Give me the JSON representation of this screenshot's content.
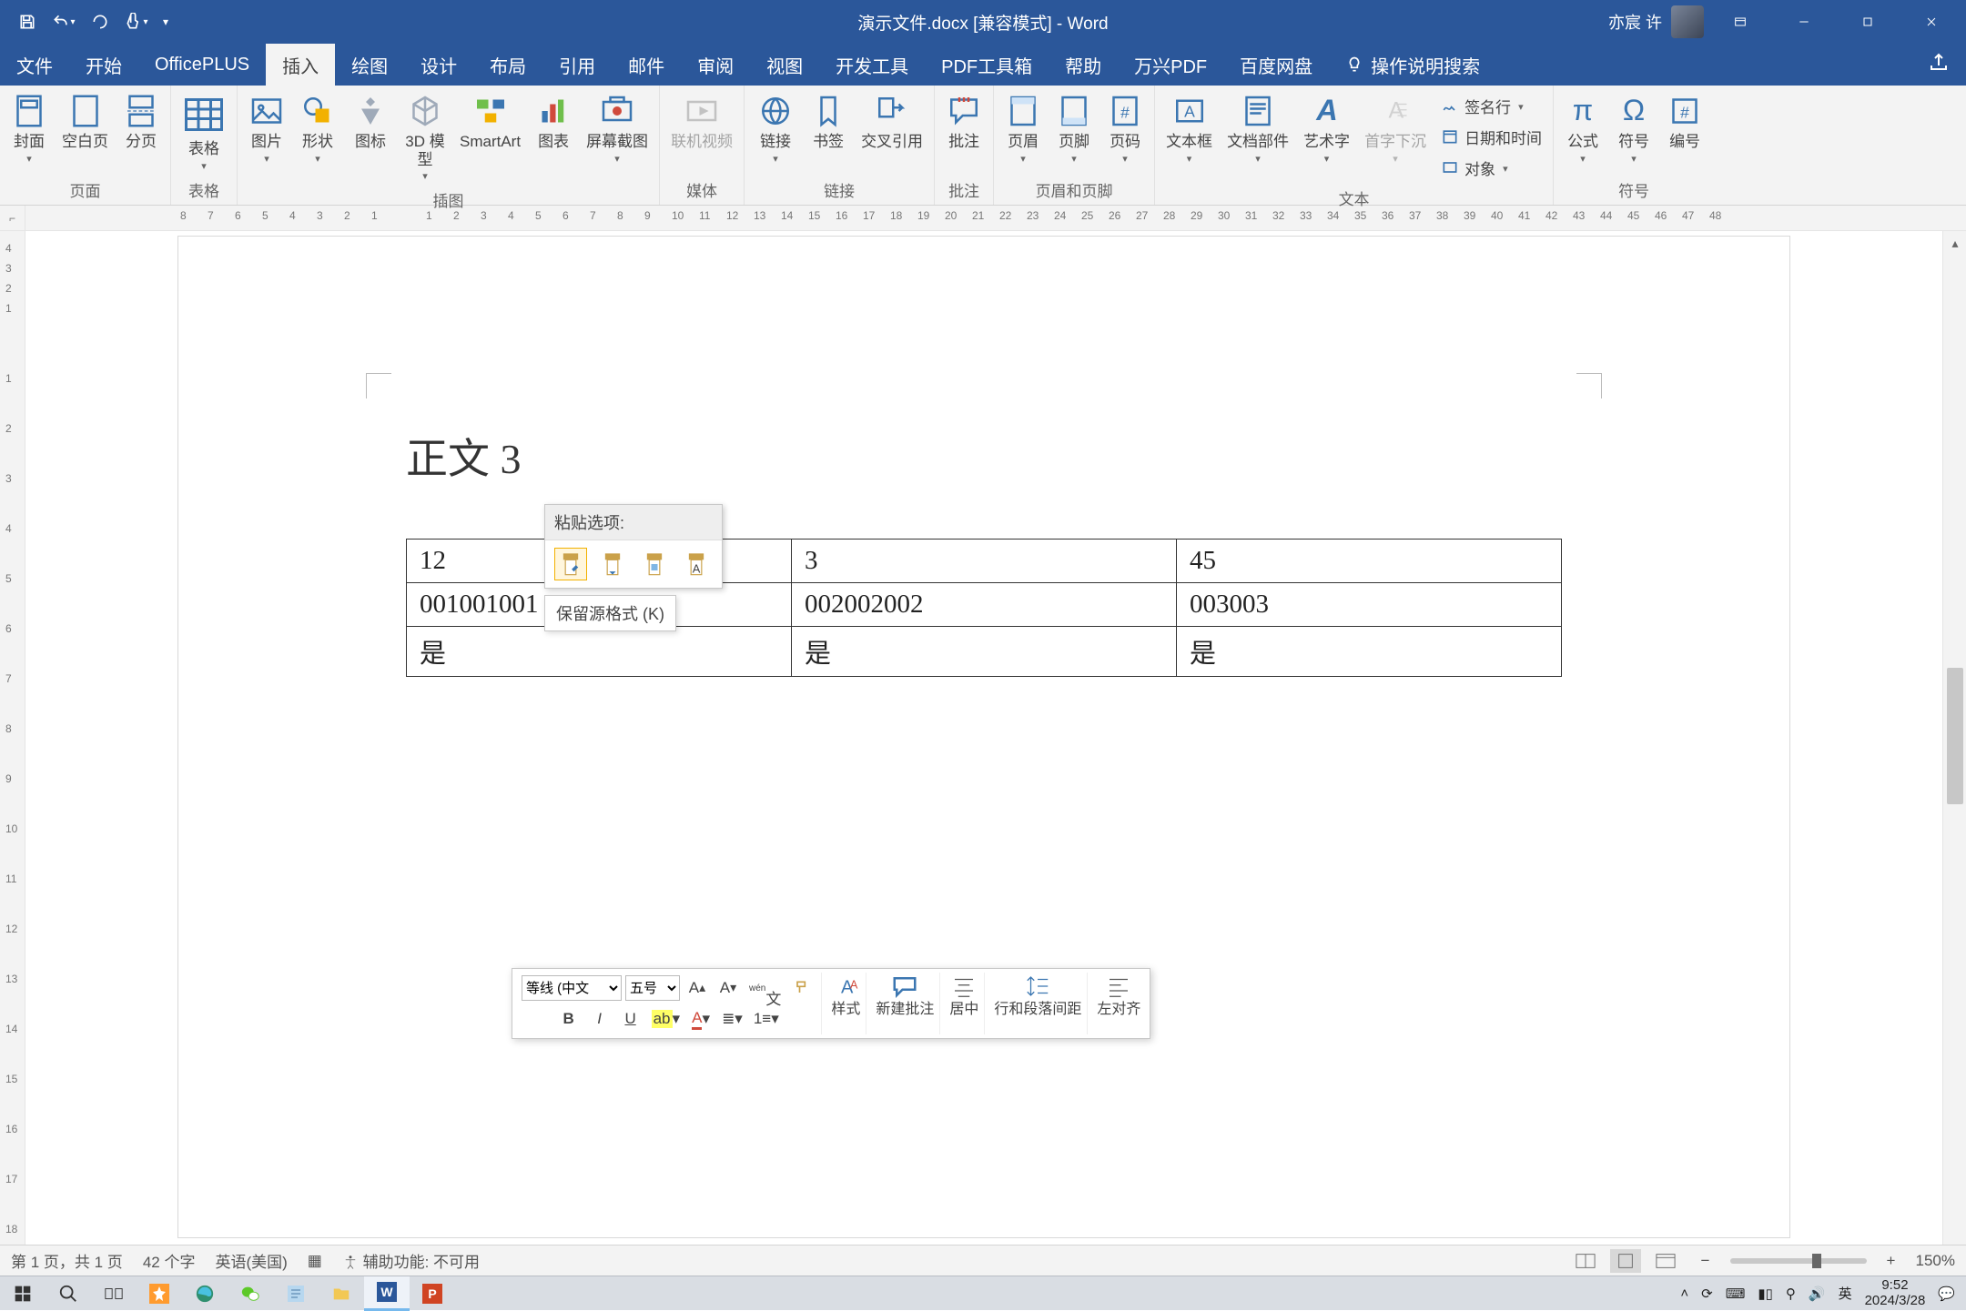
{
  "titlebar": {
    "doc_title": "演示文件.docx [兼容模式] - Word",
    "user_name": "亦宸 许"
  },
  "menu": {
    "tabs": [
      "文件",
      "开始",
      "OfficePLUS",
      "插入",
      "绘图",
      "设计",
      "布局",
      "引用",
      "邮件",
      "审阅",
      "视图",
      "开发工具",
      "PDF工具箱",
      "帮助",
      "万兴PDF",
      "百度网盘"
    ],
    "active_index": 3,
    "tell_me": "操作说明搜索"
  },
  "ribbon": {
    "groups": {
      "pages": {
        "label": "页面",
        "items": [
          "封面",
          "空白页",
          "分页"
        ]
      },
      "tables": {
        "label": "表格",
        "items": [
          "表格"
        ]
      },
      "illustrations": {
        "label": "插图",
        "items": [
          "图片",
          "形状",
          "图标",
          "3D 模型",
          "SmartArt",
          "图表",
          "屏幕截图"
        ]
      },
      "media": {
        "label": "媒体",
        "items": [
          "联机视频"
        ]
      },
      "links": {
        "label": "链接",
        "items": [
          "链接",
          "书签",
          "交叉引用"
        ]
      },
      "comments": {
        "label": "批注",
        "items": [
          "批注"
        ]
      },
      "header_footer": {
        "label": "页眉和页脚",
        "items": [
          "页眉",
          "页脚",
          "页码"
        ]
      },
      "text": {
        "label": "文本",
        "items": [
          "文本框",
          "文档部件",
          "艺术字",
          "首字下沉"
        ],
        "side": [
          "签名行",
          "日期和时间",
          "对象"
        ]
      },
      "symbols": {
        "label": "符号",
        "items": [
          "公式",
          "符号",
          "编号"
        ]
      }
    }
  },
  "paste_popup": {
    "header": "粘贴选项:",
    "tooltip": "保留源格式 (K)",
    "options": [
      "keep-source-formatting",
      "merge-formatting",
      "picture",
      "keep-text-only"
    ]
  },
  "document": {
    "heading": "正文 3",
    "table": [
      [
        "12",
        "3",
        "45"
      ],
      [
        "001001001",
        "002002002",
        "003003"
      ],
      [
        "是",
        "是",
        "是"
      ]
    ]
  },
  "mini_toolbar": {
    "font_name": "等线 (中文",
    "font_size": "五号",
    "styles_label": "样式",
    "new_comment": "新建批注",
    "center": "居中",
    "line_spacing": "行和段落间距",
    "align_left": "左对齐"
  },
  "statusbar": {
    "page": "第 1 页，共 1 页",
    "words": "42 个字",
    "language": "英语(美国)",
    "accessibility": "辅助功能: 不可用",
    "zoom": "150%"
  },
  "taskbar": {
    "time": "9:52",
    "date": "2024/3/28",
    "ime": "英"
  }
}
